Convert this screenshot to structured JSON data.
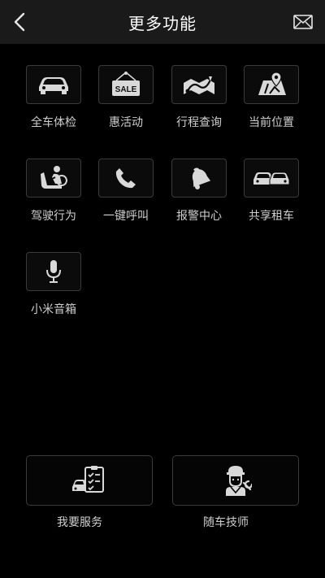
{
  "header": {
    "title": "更多功能",
    "back_icon": "back-chevron-icon",
    "mail_icon": "mail-icon"
  },
  "features": [
    {
      "label": "全车体检",
      "icon": "car-icon"
    },
    {
      "label": "惠活动",
      "icon": "sale-sign-icon"
    },
    {
      "label": "行程查询",
      "icon": "route-map-icon"
    },
    {
      "label": "当前位置",
      "icon": "location-map-icon"
    },
    {
      "label": "驾驶行为",
      "icon": "driver-seat-icon"
    },
    {
      "label": "一键呼叫",
      "icon": "phone-icon"
    },
    {
      "label": "报警中心",
      "icon": "bell-icon"
    },
    {
      "label": "共享租车",
      "icon": "two-cars-icon"
    },
    {
      "label": "小米音箱",
      "icon": "microphone-icon"
    }
  ],
  "sale_text": "SALE",
  "services": [
    {
      "label": "我要服务",
      "icon": "car-checklist-icon"
    },
    {
      "label": "随车技师",
      "icon": "mechanic-icon"
    }
  ],
  "colors": {
    "background": "#000000",
    "header": "#1a1a1a",
    "tile_border": "#3a3a3a",
    "icon": "#d9d9d9"
  }
}
